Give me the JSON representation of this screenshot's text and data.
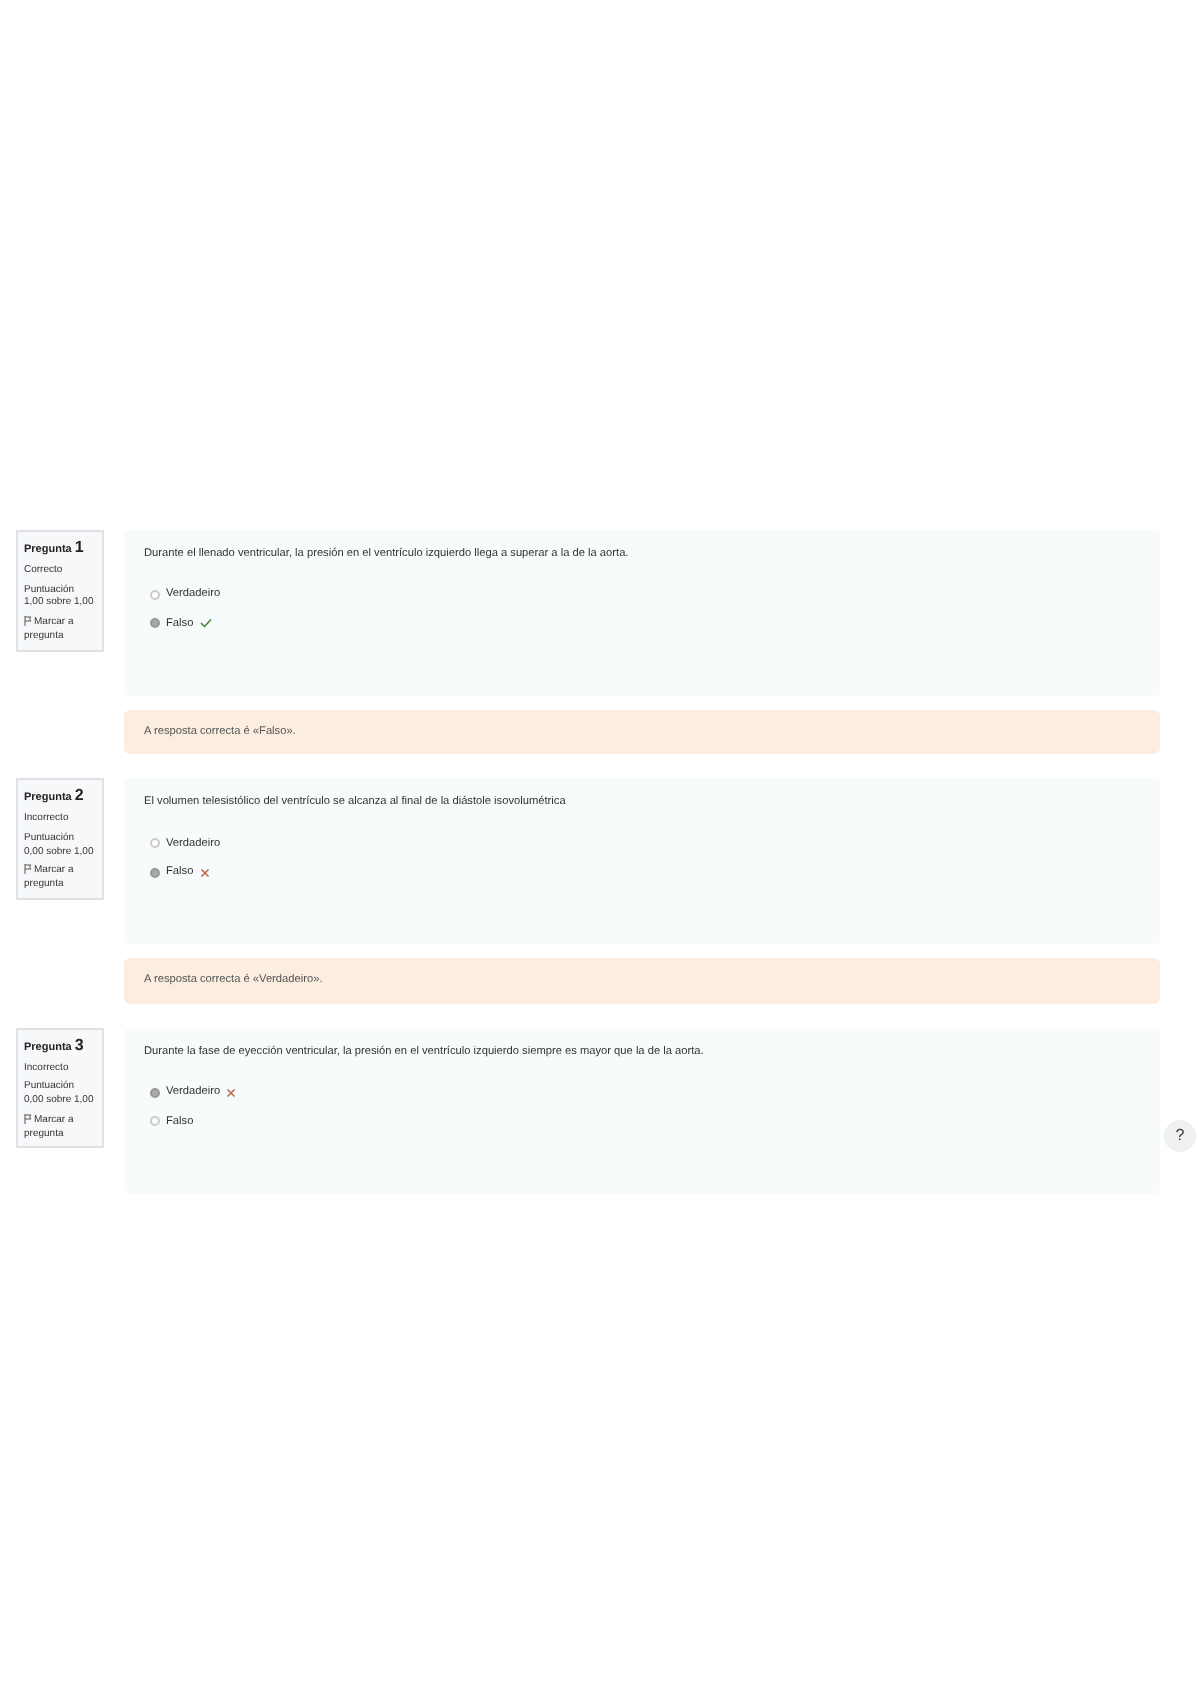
{
  "questions": [
    {
      "label": "Pregunta",
      "number": "1",
      "state": "Correcto",
      "grade_label": "Puntuación",
      "grade": "1,00 sobre 1,00",
      "flag": "Marcar a pregunta",
      "text": "Durante el llenado ventricular, la presión en el ventrículo izquierdo llega a superar a la de la aorta.",
      "options": [
        {
          "label": "Verdadeiro",
          "selected": false
        },
        {
          "label": "Falso",
          "selected": true,
          "correct": true
        }
      ],
      "feedback": "A resposta correcta é «Falso»."
    },
    {
      "label": "Pregunta",
      "number": "2",
      "state": "Incorrecto",
      "grade_label": "Puntuación",
      "grade": "0,00 sobre 1,00",
      "flag": "Marcar a pregunta",
      "text": "El volumen telesistólico del ventrículo se alcanza al final de la diástole isovolumétrica",
      "options": [
        {
          "label": "Verdadeiro",
          "selected": false
        },
        {
          "label": "Falso",
          "selected": true,
          "correct": false
        }
      ],
      "feedback": "A resposta correcta é «Verdadeiro»."
    },
    {
      "label": "Pregunta",
      "number": "3",
      "state": "Incorrecto",
      "grade_label": "Puntuación",
      "grade": "0,00 sobre 1,00",
      "flag": "Marcar a pregunta",
      "text": "Durante la fase de eyección ventricular, la presión en el ventrículo izquierdo siempre es mayor que la de la aorta.",
      "options": [
        {
          "label": "Verdadeiro",
          "selected": true,
          "correct": false
        },
        {
          "label": "Falso",
          "selected": false
        }
      ]
    }
  ],
  "help_button": "?"
}
